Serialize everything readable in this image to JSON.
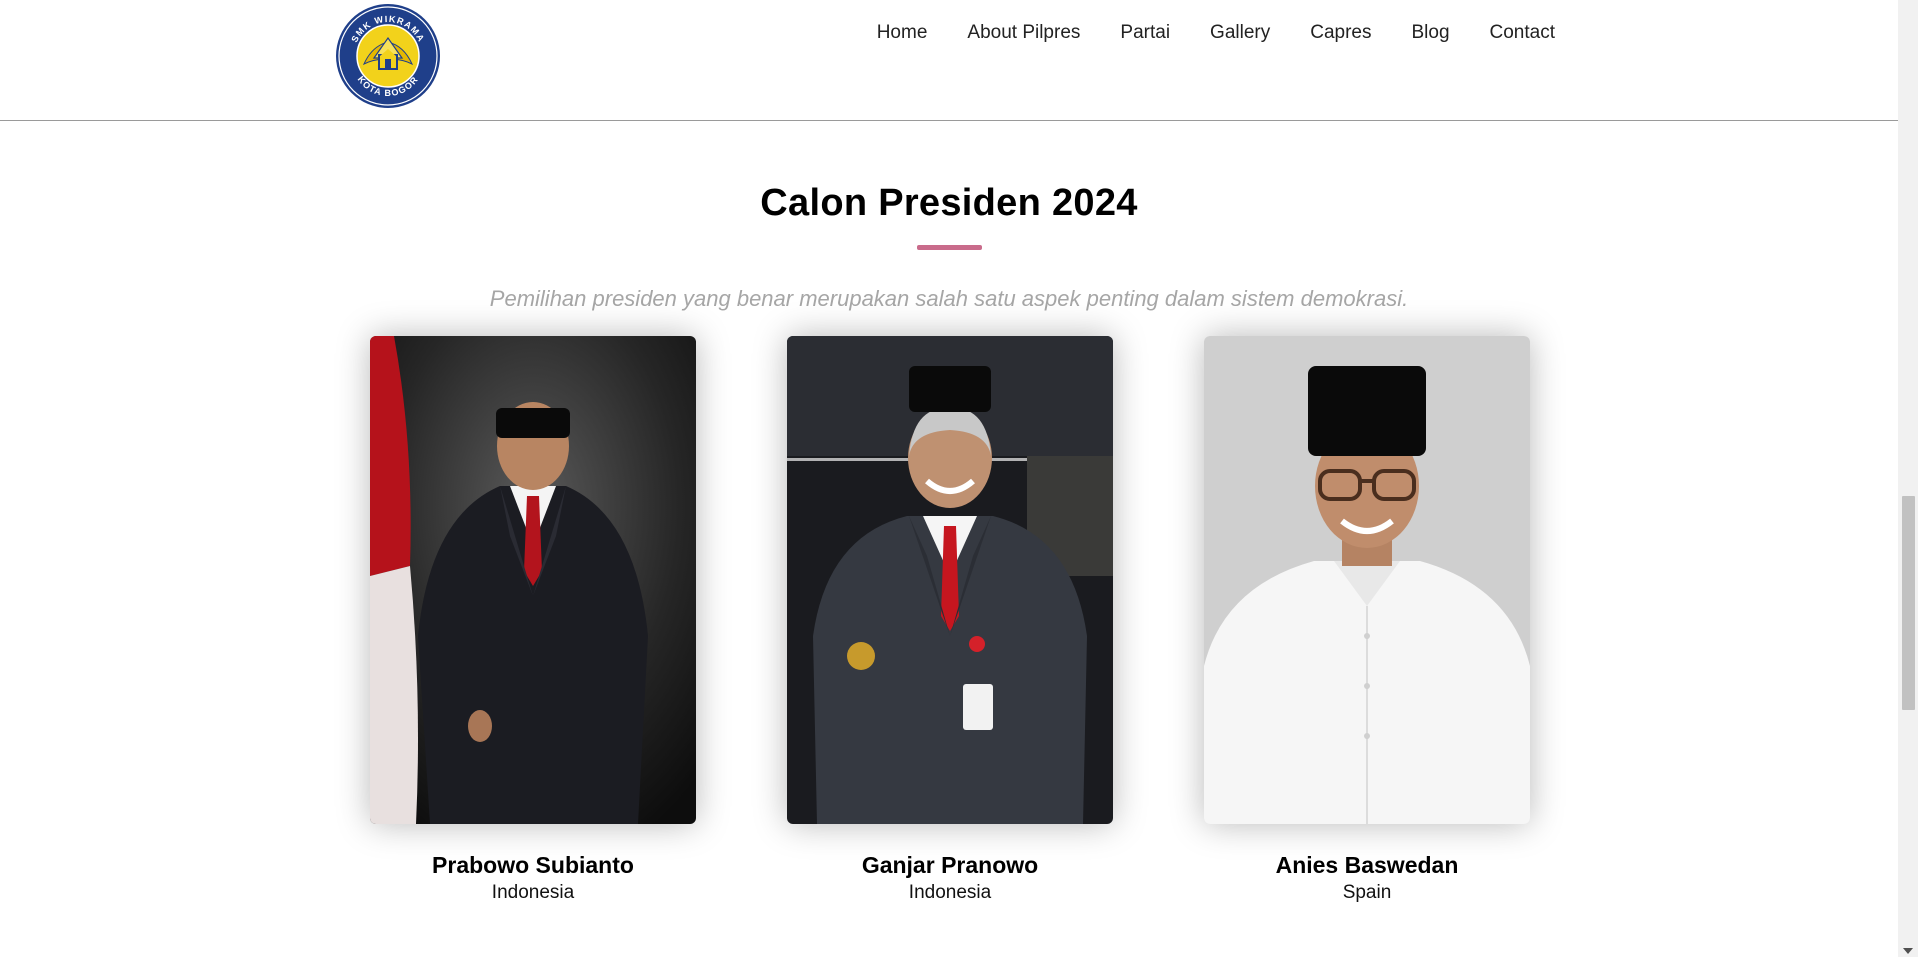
{
  "header": {
    "logo_text": {
      "top": "SMK WIKRAMA",
      "bottom": "KOTA BOGOR"
    },
    "nav": [
      {
        "label": "Home"
      },
      {
        "label": "About Pilpres"
      },
      {
        "label": "Partai"
      },
      {
        "label": "Gallery"
      },
      {
        "label": "Capres"
      },
      {
        "label": "Blog"
      },
      {
        "label": "Contact"
      }
    ]
  },
  "section": {
    "title": "Calon Presiden 2024",
    "subtitle": "Pemilihan presiden yang benar merupakan salah satu aspek penting dalam sistem demokrasi."
  },
  "candidates": [
    {
      "name": "Prabowo Subianto",
      "country": "Indonesia"
    },
    {
      "name": "Ganjar Pranowo",
      "country": "Indonesia"
    },
    {
      "name": "Anies Baswedan",
      "country": "Spain"
    }
  ],
  "colors": {
    "accent": "#c96b8b",
    "logo_blue": "#1f3f8a",
    "logo_yellow": "#f2d21b",
    "subtitle": "#a6a6a6"
  }
}
